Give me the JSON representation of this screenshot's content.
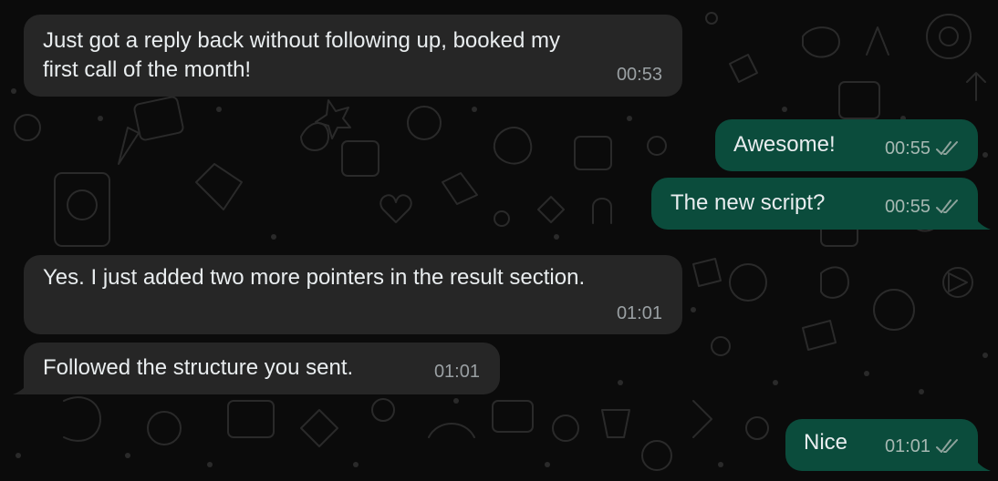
{
  "theme": {
    "background": "#0b0b0b",
    "incoming_bubble": "#262626",
    "outgoing_bubble": "#0b4c3c",
    "text": "#e9edef",
    "meta_text": "#9aa0a3"
  },
  "messages": [
    {
      "direction": "incoming",
      "lines": [
        "Just got a reply back without following up, booked my",
        "first call of the month!"
      ],
      "time": "00:53"
    },
    {
      "direction": "outgoing",
      "lines": [
        "Awesome!"
      ],
      "time": "00:55",
      "status": "read"
    },
    {
      "direction": "outgoing",
      "lines": [
        "The new script?"
      ],
      "time": "00:55",
      "status": "read"
    },
    {
      "direction": "incoming",
      "lines": [
        "Yes. I just added two more pointers in the result section."
      ],
      "time": "01:01"
    },
    {
      "direction": "incoming",
      "lines": [
        "Followed the structure you sent."
      ],
      "time": "01:01"
    },
    {
      "direction": "outgoing",
      "lines": [
        "Nice"
      ],
      "time": "01:01",
      "status": "read"
    }
  ]
}
